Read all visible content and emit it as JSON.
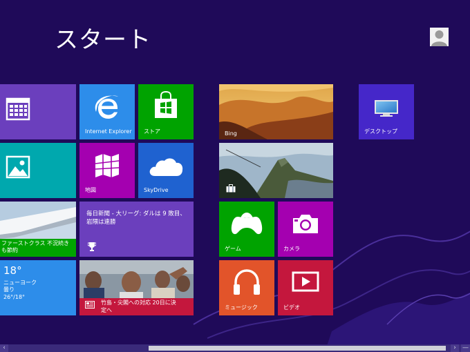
{
  "screen": {
    "title": "スタート"
  },
  "colors": {
    "background": "#1f0a59",
    "swirl": "#4a2f9b"
  },
  "tiles": {
    "calendar": {
      "icon": "calendar-icon",
      "color": "#6b3fbd"
    },
    "ie": {
      "label": "Internet Explorer",
      "icon": "internet-explorer-icon",
      "color": "#2d8dea"
    },
    "store": {
      "label": "ストア",
      "icon": "store-bag-icon",
      "color": "#00a300"
    },
    "bing": {
      "label": "Bing"
    },
    "travel_photo": {
      "icon": "suitcase-icon"
    },
    "desktop": {
      "label": "デスクトップ",
      "icon": "monitor-icon",
      "color": "#4527c9"
    },
    "photos": {
      "icon": "photo-icon",
      "color": "#00a8ae"
    },
    "maps": {
      "label": "地図",
      "icon": "map-icon",
      "color": "#a400b0"
    },
    "skydrive": {
      "label": "SkyDrive",
      "icon": "cloud-icon",
      "color": "#1f62d0"
    },
    "travel": {
      "label_line1": "ファーストクラス 不況続き",
      "label_line2": "も節約"
    },
    "sports": {
      "text": "毎日新聞 - 大リーグ: ダルは 9 敗目、岩隈は連勝",
      "icon": "trophy-icon",
      "color": "#6b3fbd"
    },
    "games": {
      "label": "ゲーム",
      "icon": "xbox-controller-icon",
      "color": "#00a300"
    },
    "camera": {
      "label": "カメラ",
      "icon": "camera-icon",
      "color": "#a400b0"
    },
    "weather": {
      "temp": "18°",
      "city": "ニューヨーク",
      "condition": "曇り",
      "range": "26°/18°",
      "color": "#2d8dea"
    },
    "news": {
      "text_line1": "竹島・尖閣への対応 20日に決",
      "text_line2": "定へ",
      "icon": "newspaper-icon",
      "color": "#c4173d"
    },
    "music": {
      "label": "ミュージック",
      "icon": "headphones-icon",
      "color": "#e2542a"
    },
    "video": {
      "label": "ビデオ",
      "icon": "video-play-icon",
      "color": "#c4173d"
    }
  },
  "scrollbar": {
    "left_arrow": "‹",
    "right_arrow": "›",
    "minimize": "—"
  }
}
